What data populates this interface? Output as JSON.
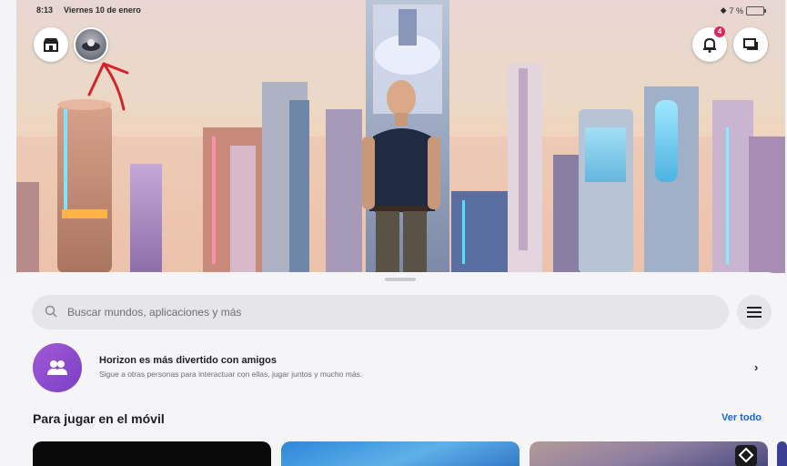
{
  "status_bar": {
    "time": "8:13",
    "date": "Viernes 10 de enero",
    "battery": "7 %"
  },
  "top_bar": {
    "store_icon": "store-icon",
    "avatar_icon": "avatar-icon",
    "notifications_icon": "bell-icon",
    "notifications_count": "4",
    "messages_icon": "chat-icon"
  },
  "search": {
    "placeholder": "Buscar mundos, aplicaciones y más",
    "menu_icon": "hamburger-icon"
  },
  "promo": {
    "icon": "people-icon",
    "title": "Horizon es más divertido con amigos",
    "subtitle": "Sigue a otras personas para interactuar con ellas, jugar juntos y mucho más.",
    "chevron": "›"
  },
  "section": {
    "title": "Para jugar en el móvil",
    "see_all": "Ver todo"
  },
  "colors": {
    "accent": "#1b64d6",
    "badge": "#e0245e",
    "promo_icon_bg": "#8e4bd0",
    "annotation_arrow": "#d4242a"
  }
}
